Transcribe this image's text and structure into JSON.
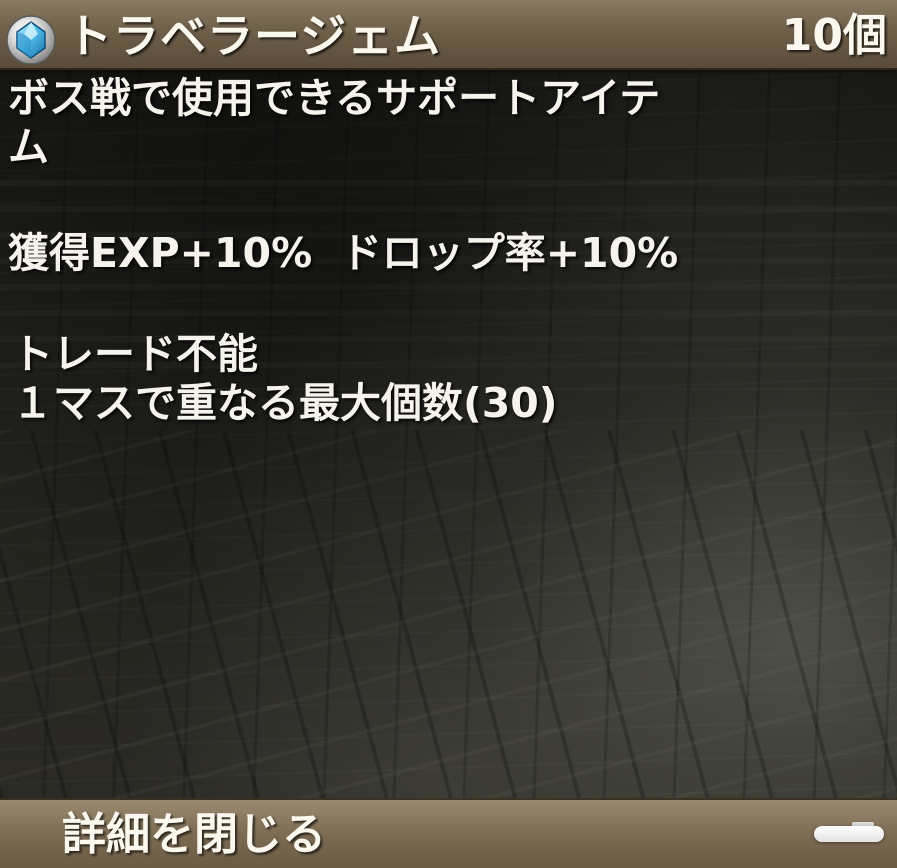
{
  "header": {
    "item_icon": "blue-gem-icon",
    "item_name": "トラベラージェム",
    "item_count": "10個"
  },
  "description": {
    "line1": "ボス戦で使用できるサポートアイテ",
    "line2": "ム",
    "effects": "獲得EXP+10%  ドロップ率+10%",
    "trade": "トレード不能",
    "stack": "１マスで重なる最大個数(30)"
  },
  "footer": {
    "close_label": "詳細を閉じる"
  },
  "colors": {
    "panel_bar": "#7c6b52",
    "text": "#f6f3ec",
    "gem": "#4fb8e8"
  }
}
